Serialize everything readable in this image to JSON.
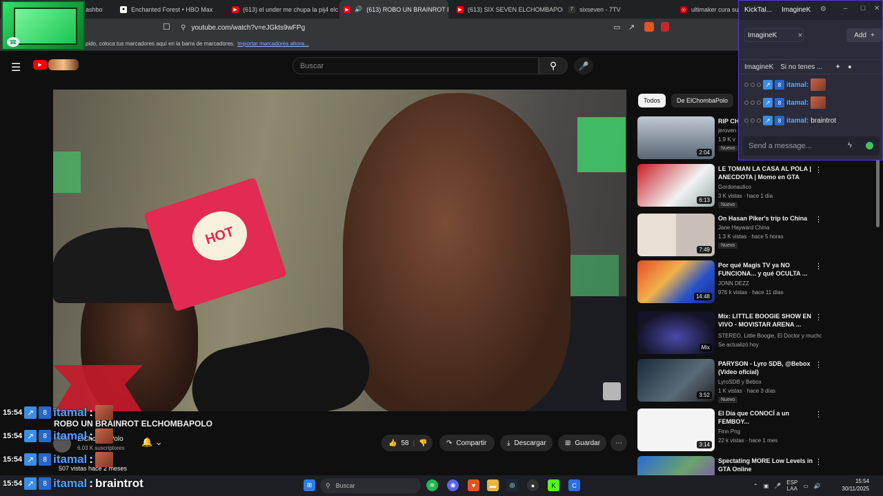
{
  "browser": {
    "tabs": [
      {
        "label": "ashbo",
        "active": false
      },
      {
        "label": "Enchanted Forest • HBO Max",
        "active": false
      },
      {
        "label": "(613) el under me chupa la pij4 elch",
        "active": false
      },
      {
        "label": "(613) ROBO UN BRAINROT E",
        "active": true
      },
      {
        "label": "(613) SIX SEVEN ELCHOMBAPOLO -",
        "active": false
      },
      {
        "label": "sixseven - 7TV",
        "active": false
      },
      {
        "label": "ultimaker cura sup",
        "active": false
      }
    ],
    "url": "youtube.com/watch?v=eJGkts9wFPg",
    "bookmarks_text": "pido, coloca tus marcadores aquí en la barra de marcadores.",
    "bookmarks_link": "Importar marcadores ahora..."
  },
  "youtube": {
    "search_placeholder": "Buscar",
    "video_title": "ROBO UN BRAINROT ELCHOMBAPOLO",
    "channel": "ElChombaPolo",
    "subscribers": "6.03 K suscriptores",
    "likes": "58",
    "share_label": "Compartir",
    "download_label": "Descargar",
    "save_label": "Guardar",
    "views": "507 vistas  hace 2 meses",
    "chips": [
      "Todos",
      "De ElChombaPolo"
    ],
    "recommendations": [
      {
        "title": "RIP CH",
        "channel": "jeroven",
        "meta": "1.9 K v",
        "badge": "Nuevo",
        "duration": "2:04"
      },
      {
        "title": "LE TOMAN LA CASA AL POLA | ANECDOTA | Momo en GTA Sa...",
        "channel": "Gordonautico",
        "meta": "3 K vistas · hace 1 día",
        "badge": "Nuevo",
        "duration": "6:13"
      },
      {
        "title": "On Hasan Piker's trip to China",
        "channel": "Jane Hayward China",
        "meta": "1.3 K vistas · hace 5 horas",
        "badge": "Nuevo",
        "duration": "7:49"
      },
      {
        "title": "Por qué Magis TV ya NO FUNCIONA... y qué OCULTA ...",
        "channel": "JONN DEZZ",
        "meta": "976 k vistas · hace 11 días",
        "badge": "",
        "duration": "14:48"
      },
      {
        "title": "Mix: LITTLE BOOGIE SHOW EN VIVO - MOVISTAR ARENA ...",
        "channel": "STEREO, Little Boogie, El Doctor y mucho...",
        "meta": "Se actualizó hoy",
        "badge": "",
        "duration": "Mix"
      },
      {
        "title": "PARYSON - Lyro SDB, @Bebox (Video oficial)",
        "channel": "LyroSDB y Bebox",
        "meta": "1 K vistas · hace 3 días",
        "badge": "Nuevo",
        "duration": "3:52"
      },
      {
        "title": "El Día que CONOCÍ a un FEMBOY...",
        "channel": "Finn Png",
        "meta": "22 k vistas · hace 1 mes",
        "badge": "",
        "duration": "3:14"
      },
      {
        "title": "Spectating MORE Low Levels in GTA Online",
        "channel": "",
        "meta": "",
        "badge": "",
        "duration": ""
      }
    ]
  },
  "chat_panel": {
    "window_tab": "KickTal...",
    "account": "ImagineK",
    "channel_tag": "ImagineK",
    "add_label": "Add",
    "subheader_user": "ImagineK",
    "subheader_text": "Si no tenes ...",
    "messages": [
      {
        "user": "itamal:",
        "text": ""
      },
      {
        "user": "itamal:",
        "text": ""
      },
      {
        "user": "itamal:",
        "text": "braintrot"
      }
    ],
    "input_placeholder": "Send a message..."
  },
  "overlay_chat": [
    {
      "time": "15:54",
      "user": "itamal",
      "text": ""
    },
    {
      "time": "15:54",
      "user": "itamal",
      "text": ""
    },
    {
      "time": "15:54",
      "user": "itamal",
      "text": ""
    },
    {
      "time": "15:54",
      "user": "itamal",
      "text": "braintrot"
    }
  ],
  "taskbar": {
    "search_placeholder": "Buscar",
    "lang": "ESP",
    "lang2": "LAA",
    "time": "15:54",
    "date": "30/11/2025"
  },
  "colors": {
    "accent": "#3ea6ff",
    "chat_user": "#4fa3ff",
    "yt_red": "#ff0000"
  }
}
